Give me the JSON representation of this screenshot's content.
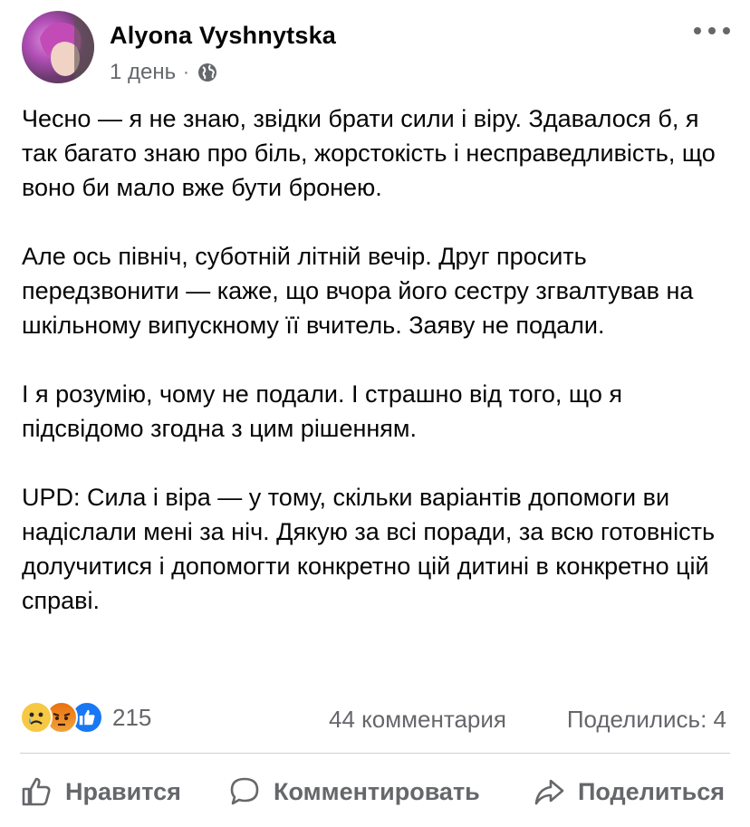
{
  "author": {
    "name": "Alyona Vyshnytska",
    "time": "1 день",
    "separator": "·",
    "privacy_icon": "globe-icon"
  },
  "menu": {
    "icon": "more-options-icon"
  },
  "post": {
    "paragraphs": [
      "Чесно — я не знаю, звідки брати сили і віру. Здавалося б, я так багато знаю про біль, жорстокість і несправедливість, що воно би мало вже бути бронею.",
      "Але ось північ, суботній літній вечір. Друг просить передзвонити — каже, що вчора його сестру згвалтував на шкільному випускному її вчитель. Заяву не подали.",
      "І я розумію, чому не подали. І страшно від того, що я підсвідомо згодна з цим рішенням.",
      "UPD: Сила і віра — у тому, скільки варіантів допомоги ви надіслали мені за ніч. Дякую за всі поради, за всю готовність долучитися і допомогти конкретно цій дитині в конкретно цій справі."
    ]
  },
  "stats": {
    "reaction_icons": [
      "sad-reaction-icon",
      "angry-reaction-icon",
      "like-reaction-icon"
    ],
    "reactions": "215",
    "comments": "44 комментария",
    "shares": "Поделились: 4"
  },
  "actions": {
    "like": "Нравится",
    "comment": "Комментировать",
    "share": "Поделиться"
  },
  "colors": {
    "text": "#050505",
    "secondary": "#65676b",
    "divider": "#ced0d4",
    "like_blue": "#1877f2"
  }
}
